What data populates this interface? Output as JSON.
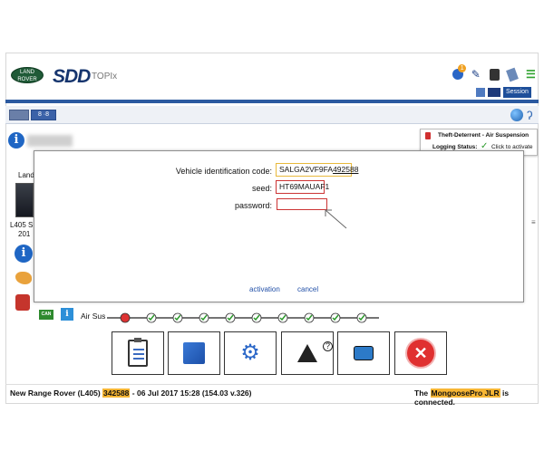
{
  "header": {
    "logo_text": "LAND ROVER",
    "app_name": "SDD",
    "app_subtitle": "TOPIx",
    "icon_badge": "1",
    "session_label": "Session"
  },
  "toolbar": {
    "tab2_label": "8 ·8"
  },
  "vehicle_panel": {
    "line1": "Land",
    "line2": "L405 S",
    "line3": "201"
  },
  "alert": {
    "title": "Theft-Deterrent - Air Suspension",
    "status_label": "Logging Status:",
    "status_action": "Click to activate"
  },
  "dialog": {
    "vin_label": "Vehicle identification code:",
    "vin_prefix": "SALGA2VF9FA",
    "vin_suffix": "492588",
    "seed_label": "seed:",
    "seed_value": "HT69MAUAF1",
    "password_label": "password:",
    "password_value": "",
    "activation_label": "activation",
    "cancel_label": "cancel"
  },
  "network": {
    "can_label": "CAN",
    "module_label": "Air Sus",
    "nodes": 10
  },
  "status_bar": {
    "vehicle": "New Range Rover (L405)",
    "vin_short": "342588",
    "date_info": "- 06 Jul 2017 15:28 (154.03 v.326)",
    "conn_prefix": "The",
    "device": "MongoosePro JLR",
    "conn_suffix": "is connected."
  },
  "colors": {
    "brand_blue": "#16356e",
    "highlight": "#f7b634",
    "error_red": "#e03030",
    "check_green": "#2c9a2c"
  }
}
